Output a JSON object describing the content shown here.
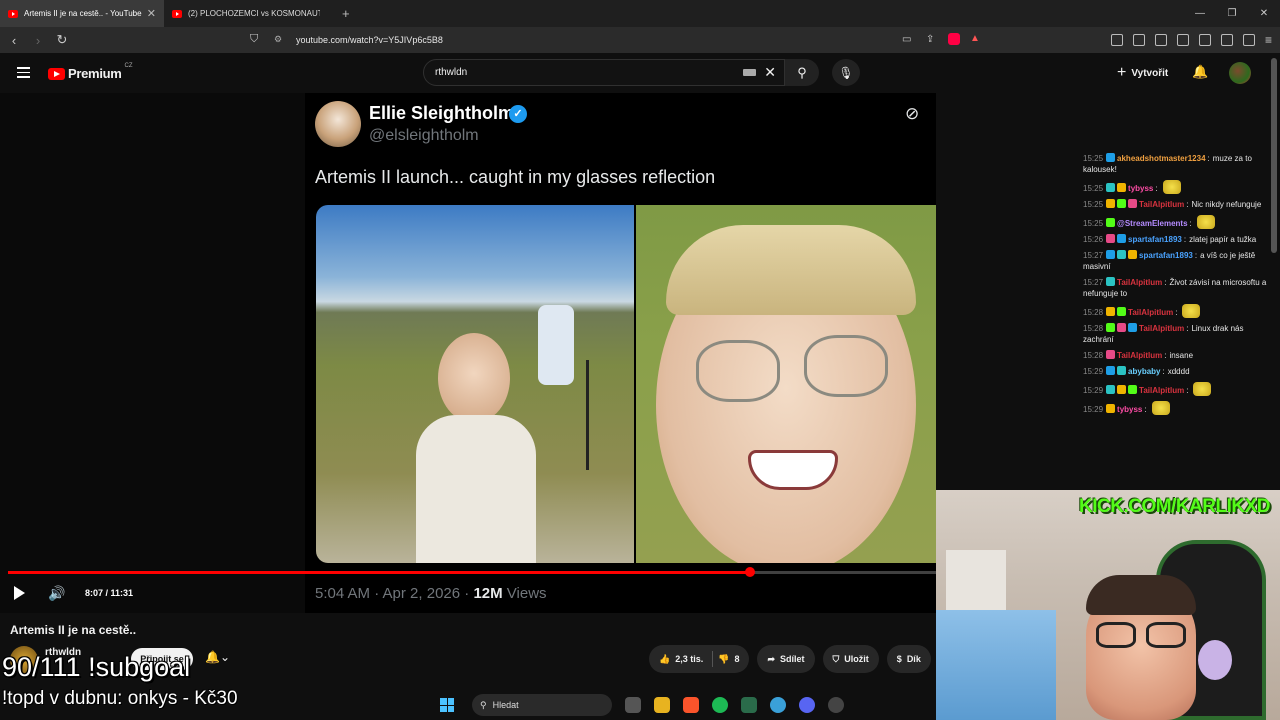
{
  "browser": {
    "tabs": [
      {
        "title": "Artemis II je na cestě.. - YouTube",
        "active": true
      },
      {
        "title": "(2) PLOCHOZEMCI vs KOSMONAUT",
        "active": false
      }
    ],
    "url": "youtube.com/watch?v=Y5JIVp6c5B8"
  },
  "youtube": {
    "logo_text": "Premium",
    "region": "CZ",
    "search_query": "rthwldn",
    "create_label": "Vytvořit"
  },
  "tweet": {
    "name": "Ellie Sleightholm",
    "handle": "@elsleightholm",
    "text": "Artemis II launch... caught in my glasses reflection",
    "date": "5:04 AM · Apr 2, 2026 · ",
    "views_count": "12M",
    "views_label": " Views"
  },
  "player": {
    "time": "8:07 / 11:31",
    "progress": 0.8
  },
  "video": {
    "title": "Artemis II je na cestě..",
    "channel": "rthwldn",
    "join_label": "Připojit se",
    "likes": "2,3 tis.",
    "dislikes": "8",
    "share_label": "Sdílet",
    "save_label": "Uložit",
    "thanks_label": "Dík"
  },
  "overlay": {
    "subgoal": "90/111 !subgoal",
    "topd": "!topd v dubnu: onkys - Kč30",
    "kick": "KICK.COM/KARLIKXD"
  },
  "taskbar": {
    "search_label": "Hledat"
  },
  "chat": [
    {
      "time": "15:25",
      "user": "akheadshotmaster1234",
      "color": "#f0a040",
      "text": "muze za to kalousek!"
    },
    {
      "time": "15:25",
      "user": "tybyss",
      "color": "#ff4da6",
      "text": ""
    },
    {
      "time": "15:25",
      "user": "TailAlpitlum",
      "color": "#d9333f",
      "text": "Nic nikdy nefunguje"
    },
    {
      "time": "15:25",
      "user": "@StreamElements",
      "color": "#b58cff",
      "text": ""
    },
    {
      "time": "15:26",
      "user": "spartafan1893",
      "color": "#4aa3ff",
      "text": "zlatej papír a tužka"
    },
    {
      "time": "15:27",
      "user": "spartafan1893",
      "color": "#4aa3ff",
      "text": "a víš co je ještě masivní"
    },
    {
      "time": "15:27",
      "user": "TailAlpitlum",
      "color": "#d9333f",
      "text": "Život závisí na microsoftu a nefunguje to"
    },
    {
      "time": "15:28",
      "user": "TailAlpitlum",
      "color": "#d9333f",
      "text": ""
    },
    {
      "time": "15:28",
      "user": "TailAlpitlum",
      "color": "#d9333f",
      "text": "Linux drak nás zachrání"
    },
    {
      "time": "15:28",
      "user": "TailAlpitlum",
      "color": "#d9333f",
      "text": "insane"
    },
    {
      "time": "15:29",
      "user": "abybaby",
      "color": "#6ad0ff",
      "text": "xdddd"
    },
    {
      "time": "15:29",
      "user": "TailAlpitlum",
      "color": "#d9333f",
      "text": ""
    },
    {
      "time": "15:29",
      "user": "tybyss",
      "color": "#ff4da6",
      "text": ""
    }
  ]
}
